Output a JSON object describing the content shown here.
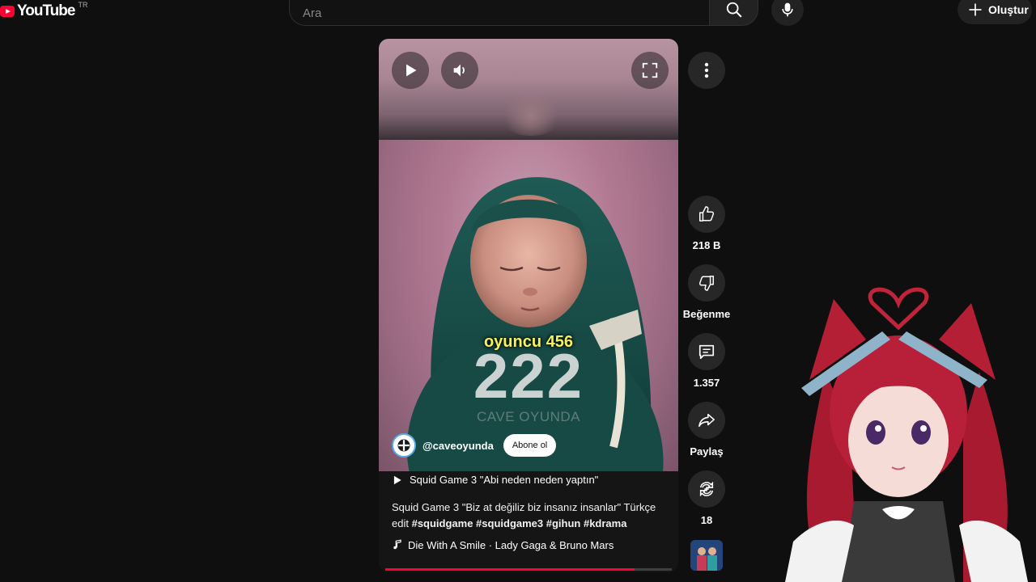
{
  "header": {
    "logo_text": "YouTube",
    "region": "TR",
    "search_placeholder": "Ara",
    "create_label": "Oluştur"
  },
  "video": {
    "caption": "oyuncu 456",
    "big_number": "222",
    "watermark": "CAVE OYUNDA",
    "channel": "@caveoyunda",
    "subscribe_label": "Abone ol",
    "playlist_title": "Squid Game 3 \"Abi neden neden yaptın\"",
    "description_text": "Squid Game 3 \"Biz at değiliz biz insanız insanlar\" Türkçe edit",
    "hashtags": "#squidgame #squidgame3 #gihun #kdrama",
    "music": "Die With A Smile · Lady Gaga & Bruno Mars",
    "progress_fraction": 0.87
  },
  "actions": {
    "likes": "218 B",
    "dislike_label": "Beğenme",
    "comments": "1.357",
    "share_label": "Paylaş",
    "remix_count": "18"
  },
  "colors": {
    "accent": "#ff0033",
    "caption": "#f5f35a",
    "background": "#0f0f0f"
  },
  "icons": [
    "youtube-logo-icon",
    "search-icon",
    "mic-icon",
    "plus-icon",
    "play-icon",
    "volume-icon",
    "fullscreen-icon",
    "more-vert-icon",
    "thumb-up-icon",
    "thumb-down-icon",
    "comment-icon",
    "share-icon",
    "remix-icon",
    "music-note-icon",
    "playlist-play-icon"
  ]
}
